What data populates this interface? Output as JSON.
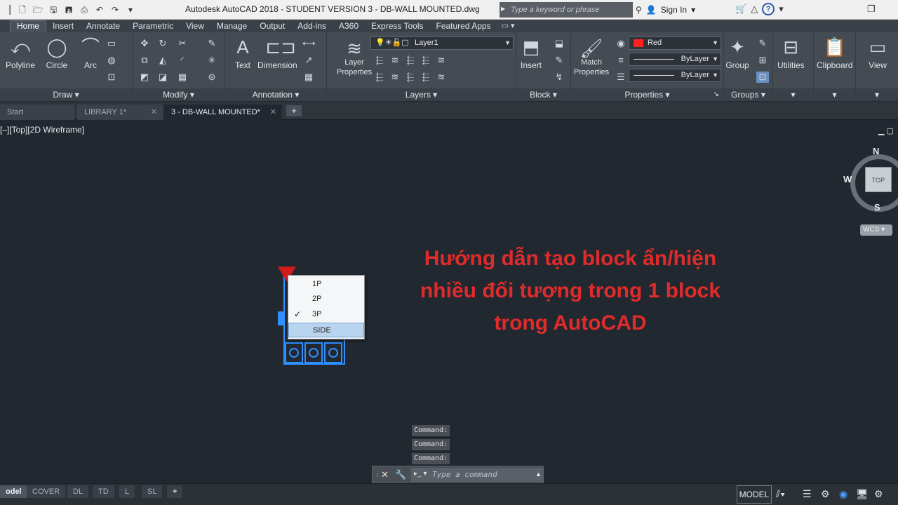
{
  "app": {
    "title": "Autodesk AutoCAD 2018 - STUDENT VERSION    3 - DB-WALL MOUNTED.dwg",
    "search_placeholder": "Type a keyword or phrase",
    "signin_label": "Sign In"
  },
  "ribbon_tabs": [
    "Home",
    "Insert",
    "Annotate",
    "Parametric",
    "View",
    "Manage",
    "Output",
    "Add-ins",
    "A360",
    "Express Tools",
    "Featured Apps"
  ],
  "ribbon": {
    "draw": {
      "title": "Draw",
      "polyline": "Polyline",
      "circle": "Circle",
      "arc": "Arc"
    },
    "modify": {
      "title": "Modify"
    },
    "annotation": {
      "title": "Annotation",
      "text": "Text",
      "dimension": "Dimension"
    },
    "layers": {
      "title": "Layers",
      "layer_properties_1": "Layer",
      "layer_properties_2": "Properties",
      "current_layer": "Layer1"
    },
    "block": {
      "title": "Block",
      "insert": "Insert"
    },
    "properties": {
      "title": "Properties",
      "match_1": "Match",
      "match_2": "Properties",
      "color": "Red",
      "linetype": "ByLayer",
      "lineweight": "ByLayer"
    },
    "groups": {
      "title": "Groups",
      "group": "Group"
    },
    "utilities": "Utilities",
    "clipboard": "Clipboard",
    "view": "View"
  },
  "doc_tabs": [
    {
      "label": "Start"
    },
    {
      "label": "LIBRARY 1*"
    },
    {
      "label": "3 - DB-WALL MOUNTED*"
    }
  ],
  "viewport": {
    "label": "[–][Top][2D Wireframe]"
  },
  "viewcube": {
    "n": "N",
    "s": "S",
    "w": "W",
    "face": "TOP",
    "wcs": "WCS"
  },
  "overlay": {
    "line1": "Hướng dẫn tạo block ẩn/hiện",
    "line2": "nhiều đối tượng trong 1 block",
    "line3": "trong AutoCAD"
  },
  "visibility_menu": {
    "items": [
      "1P",
      "2P",
      "3P",
      "SIDE"
    ],
    "checked": "3P",
    "highlighted": "SIDE"
  },
  "command": {
    "history": [
      "Command:",
      "Command:",
      "Command:"
    ],
    "placeholder": "Type a command"
  },
  "layout_tabs": [
    "odel",
    "COVER",
    "DL",
    "TD",
    "L",
    "SL"
  ],
  "status": {
    "model": "MODEL"
  },
  "colors": {
    "accent_red": "#e02b2b",
    "block_blue": "#2f8fff",
    "canvas": "#212830"
  }
}
